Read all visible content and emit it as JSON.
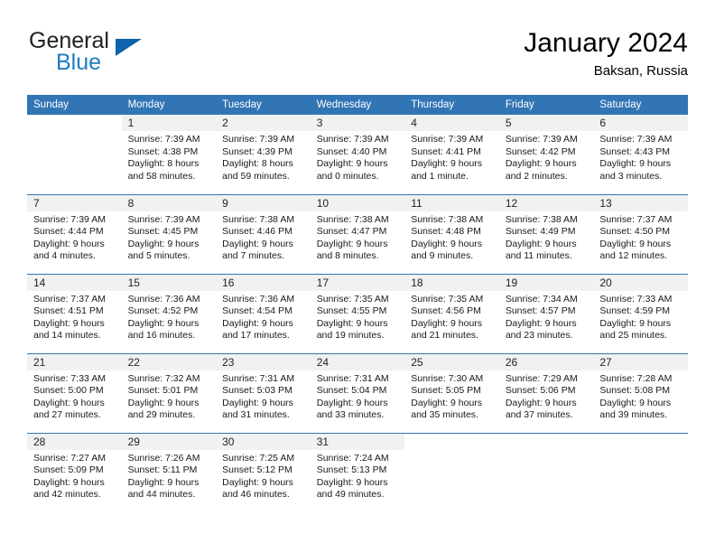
{
  "brand": {
    "word_one": "General",
    "word_two": "Blue",
    "flag_icon": "triangle-flag-icon"
  },
  "header": {
    "title": "January 2024",
    "subtitle": "Baksan, Russia"
  },
  "theme": {
    "header_blue": "#3275b5",
    "brand_blue": "#1c7bc2",
    "flag_blue": "#0e63ab",
    "daynum_band": "#f1f1f1",
    "text": "#1a1a1a"
  },
  "calendar": {
    "weekday_headers": [
      "Sunday",
      "Monday",
      "Tuesday",
      "Wednesday",
      "Thursday",
      "Friday",
      "Saturday"
    ],
    "weeks": [
      [
        {
          "day": "",
          "lines": []
        },
        {
          "day": "1",
          "lines": [
            "Sunrise: 7:39 AM",
            "Sunset: 4:38 PM",
            "Daylight: 8 hours",
            "and 58 minutes."
          ]
        },
        {
          "day": "2",
          "lines": [
            "Sunrise: 7:39 AM",
            "Sunset: 4:39 PM",
            "Daylight: 8 hours",
            "and 59 minutes."
          ]
        },
        {
          "day": "3",
          "lines": [
            "Sunrise: 7:39 AM",
            "Sunset: 4:40 PM",
            "Daylight: 9 hours",
            "and 0 minutes."
          ]
        },
        {
          "day": "4",
          "lines": [
            "Sunrise: 7:39 AM",
            "Sunset: 4:41 PM",
            "Daylight: 9 hours",
            "and 1 minute."
          ]
        },
        {
          "day": "5",
          "lines": [
            "Sunrise: 7:39 AM",
            "Sunset: 4:42 PM",
            "Daylight: 9 hours",
            "and 2 minutes."
          ]
        },
        {
          "day": "6",
          "lines": [
            "Sunrise: 7:39 AM",
            "Sunset: 4:43 PM",
            "Daylight: 9 hours",
            "and 3 minutes."
          ]
        }
      ],
      [
        {
          "day": "7",
          "lines": [
            "Sunrise: 7:39 AM",
            "Sunset: 4:44 PM",
            "Daylight: 9 hours",
            "and 4 minutes."
          ]
        },
        {
          "day": "8",
          "lines": [
            "Sunrise: 7:39 AM",
            "Sunset: 4:45 PM",
            "Daylight: 9 hours",
            "and 5 minutes."
          ]
        },
        {
          "day": "9",
          "lines": [
            "Sunrise: 7:38 AM",
            "Sunset: 4:46 PM",
            "Daylight: 9 hours",
            "and 7 minutes."
          ]
        },
        {
          "day": "10",
          "lines": [
            "Sunrise: 7:38 AM",
            "Sunset: 4:47 PM",
            "Daylight: 9 hours",
            "and 8 minutes."
          ]
        },
        {
          "day": "11",
          "lines": [
            "Sunrise: 7:38 AM",
            "Sunset: 4:48 PM",
            "Daylight: 9 hours",
            "and 9 minutes."
          ]
        },
        {
          "day": "12",
          "lines": [
            "Sunrise: 7:38 AM",
            "Sunset: 4:49 PM",
            "Daylight: 9 hours",
            "and 11 minutes."
          ]
        },
        {
          "day": "13",
          "lines": [
            "Sunrise: 7:37 AM",
            "Sunset: 4:50 PM",
            "Daylight: 9 hours",
            "and 12 minutes."
          ]
        }
      ],
      [
        {
          "day": "14",
          "lines": [
            "Sunrise: 7:37 AM",
            "Sunset: 4:51 PM",
            "Daylight: 9 hours",
            "and 14 minutes."
          ]
        },
        {
          "day": "15",
          "lines": [
            "Sunrise: 7:36 AM",
            "Sunset: 4:52 PM",
            "Daylight: 9 hours",
            "and 16 minutes."
          ]
        },
        {
          "day": "16",
          "lines": [
            "Sunrise: 7:36 AM",
            "Sunset: 4:54 PM",
            "Daylight: 9 hours",
            "and 17 minutes."
          ]
        },
        {
          "day": "17",
          "lines": [
            "Sunrise: 7:35 AM",
            "Sunset: 4:55 PM",
            "Daylight: 9 hours",
            "and 19 minutes."
          ]
        },
        {
          "day": "18",
          "lines": [
            "Sunrise: 7:35 AM",
            "Sunset: 4:56 PM",
            "Daylight: 9 hours",
            "and 21 minutes."
          ]
        },
        {
          "day": "19",
          "lines": [
            "Sunrise: 7:34 AM",
            "Sunset: 4:57 PM",
            "Daylight: 9 hours",
            "and 23 minutes."
          ]
        },
        {
          "day": "20",
          "lines": [
            "Sunrise: 7:33 AM",
            "Sunset: 4:59 PM",
            "Daylight: 9 hours",
            "and 25 minutes."
          ]
        }
      ],
      [
        {
          "day": "21",
          "lines": [
            "Sunrise: 7:33 AM",
            "Sunset: 5:00 PM",
            "Daylight: 9 hours",
            "and 27 minutes."
          ]
        },
        {
          "day": "22",
          "lines": [
            "Sunrise: 7:32 AM",
            "Sunset: 5:01 PM",
            "Daylight: 9 hours",
            "and 29 minutes."
          ]
        },
        {
          "day": "23",
          "lines": [
            "Sunrise: 7:31 AM",
            "Sunset: 5:03 PM",
            "Daylight: 9 hours",
            "and 31 minutes."
          ]
        },
        {
          "day": "24",
          "lines": [
            "Sunrise: 7:31 AM",
            "Sunset: 5:04 PM",
            "Daylight: 9 hours",
            "and 33 minutes."
          ]
        },
        {
          "day": "25",
          "lines": [
            "Sunrise: 7:30 AM",
            "Sunset: 5:05 PM",
            "Daylight: 9 hours",
            "and 35 minutes."
          ]
        },
        {
          "day": "26",
          "lines": [
            "Sunrise: 7:29 AM",
            "Sunset: 5:06 PM",
            "Daylight: 9 hours",
            "and 37 minutes."
          ]
        },
        {
          "day": "27",
          "lines": [
            "Sunrise: 7:28 AM",
            "Sunset: 5:08 PM",
            "Daylight: 9 hours",
            "and 39 minutes."
          ]
        }
      ],
      [
        {
          "day": "28",
          "lines": [
            "Sunrise: 7:27 AM",
            "Sunset: 5:09 PM",
            "Daylight: 9 hours",
            "and 42 minutes."
          ]
        },
        {
          "day": "29",
          "lines": [
            "Sunrise: 7:26 AM",
            "Sunset: 5:11 PM",
            "Daylight: 9 hours",
            "and 44 minutes."
          ]
        },
        {
          "day": "30",
          "lines": [
            "Sunrise: 7:25 AM",
            "Sunset: 5:12 PM",
            "Daylight: 9 hours",
            "and 46 minutes."
          ]
        },
        {
          "day": "31",
          "lines": [
            "Sunrise: 7:24 AM",
            "Sunset: 5:13 PM",
            "Daylight: 9 hours",
            "and 49 minutes."
          ]
        },
        {
          "day": "",
          "lines": []
        },
        {
          "day": "",
          "lines": []
        },
        {
          "day": "",
          "lines": []
        }
      ]
    ]
  }
}
